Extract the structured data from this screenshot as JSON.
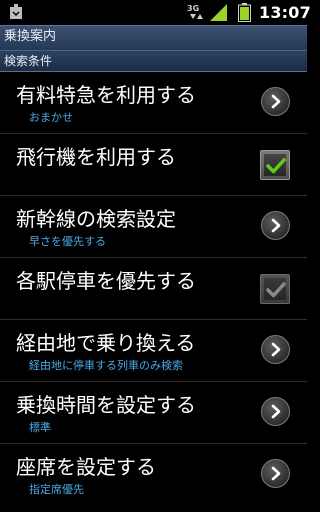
{
  "status_bar": {
    "network": "3G",
    "time": "13:07"
  },
  "title_bar": {
    "title": "乗換案内"
  },
  "section": {
    "header": "検索条件"
  },
  "preferences": [
    {
      "title": "有料特急を利用する",
      "summary": "おまかせ",
      "control": "chevron"
    },
    {
      "title": "飛行機を利用する",
      "summary": "",
      "control": "checkbox",
      "checked": true,
      "enabled": true
    },
    {
      "title": "新幹線の検索設定",
      "summary": "早さを優先する",
      "control": "chevron"
    },
    {
      "title": "各駅停車を優先する",
      "summary": "",
      "control": "checkbox",
      "checked": true,
      "enabled": false
    },
    {
      "title": "経由地で乗り換える",
      "summary": "経由地に停車する列車のみ検索",
      "control": "chevron"
    },
    {
      "title": "乗換時間を設定する",
      "summary": "標準",
      "control": "chevron"
    },
    {
      "title": "座席を設定する",
      "summary": "指定席優先",
      "control": "chevron"
    }
  ],
  "colors": {
    "summary_text": "#4aa8e6",
    "check_enabled": "#5fcf1a",
    "check_disabled": "#8a8a8a",
    "title_bar": "#2f4566"
  }
}
